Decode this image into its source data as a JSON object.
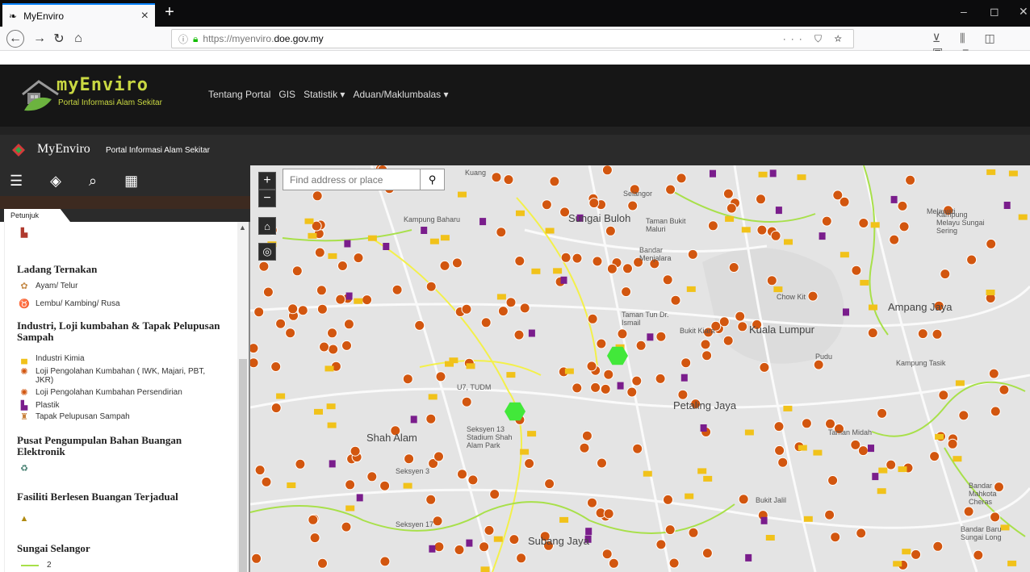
{
  "browser": {
    "tab_title": "MyEnviro",
    "tab_close": "×",
    "new_tab": "+",
    "url_scheme": "https://myenviro.",
    "url_host": "doe.gov.my",
    "url_tools": "··· ⛉ ☆",
    "toolbar_icons": "⊻ ⫼ ◫ ▣ ≡",
    "win_min": "–",
    "win_max": "◻",
    "win_close": "✕"
  },
  "site": {
    "logo_text": "myEnviro",
    "logo_sub": "Portal Informasi Alam Sekitar",
    "nav": [
      "Tentang Portal",
      "GIS",
      "Statistik ▾",
      "Aduan/Maklumbalas ▾"
    ]
  },
  "app": {
    "title": "MyEnviro",
    "subtitle": "Portal Informasi Alam Sekitar"
  },
  "sidebar": {
    "tab": "Petunjuk",
    "legend": [
      {
        "type": "icon",
        "icon": "factory-icon"
      },
      {
        "type": "head",
        "text": "Ladang Ternakan"
      },
      {
        "type": "item",
        "icon": "chicken-icon",
        "text": "Ayam/ Telur"
      },
      {
        "type": "item",
        "icon": "cow-icon",
        "text": "Lembu/ Kambing/ Rusa"
      },
      {
        "type": "head",
        "text": "Industri, Loji kumbahan & Tapak Pelupusan Sampah"
      },
      {
        "type": "item",
        "icon": "chemical-industry-icon",
        "text": "Industri Kimia"
      },
      {
        "type": "item",
        "icon": "sewage-plant-icon",
        "text": "Loji Pengolahan Kumbahan ( IWK, Majari, PBT, JKR)"
      },
      {
        "type": "item",
        "icon": "sewage-plant-icon",
        "text": "Loji Pengolahan Kumbahan Persendirian"
      },
      {
        "type": "item",
        "icon": "plastic-factory-icon",
        "text": "Plastik"
      },
      {
        "type": "item",
        "icon": "landfill-icon",
        "text": "Tapak Pelupusan Sampah"
      },
      {
        "type": "head",
        "text": "Pusat Pengumpulan Bahan Buangan Elektronik"
      },
      {
        "type": "icon",
        "icon": "ewaste-icon"
      },
      {
        "type": "head",
        "text": "Fasiliti Berlesen Buangan Terjadual"
      },
      {
        "type": "icon",
        "icon": "hazard-icon"
      },
      {
        "type": "head",
        "text": "Sungai Selangor"
      },
      {
        "type": "item",
        "icon": "river-line-icon",
        "text": "2"
      }
    ]
  },
  "map": {
    "search_placeholder": "Find address or place",
    "zoom_in": "+",
    "zoom_out": "−",
    "places": [
      {
        "name": "Kuang",
        "cls": ""
      },
      {
        "name": "Selangor",
        "cls": ""
      },
      {
        "name": "Kampung Baharu",
        "cls": ""
      },
      {
        "name": "Sungai Buloh",
        "cls": "big"
      },
      {
        "name": "Taman Bukit Maluri",
        "cls": ""
      },
      {
        "name": "Bandar Menjalara",
        "cls": ""
      },
      {
        "name": "Melawati",
        "cls": ""
      },
      {
        "name": "Kampung Melayu Sungai Sering",
        "cls": ""
      },
      {
        "name": "Chow Kit",
        "cls": ""
      },
      {
        "name": "Ampang Jaya",
        "cls": "big"
      },
      {
        "name": "Taman Tun Dr. Ismail",
        "cls": ""
      },
      {
        "name": "Bukit Kiara",
        "cls": ""
      },
      {
        "name": "Kuala Lumpur",
        "cls": "big"
      },
      {
        "name": "Pudu",
        "cls": ""
      },
      {
        "name": "Kampung Tasik",
        "cls": ""
      },
      {
        "name": "U7, TUDM",
        "cls": ""
      },
      {
        "name": "Petaling Jaya",
        "cls": "big"
      },
      {
        "name": "Seksyen 13 Stadium Shah Alam Park",
        "cls": ""
      },
      {
        "name": "Shah Alam",
        "cls": "big"
      },
      {
        "name": "Taman Midah",
        "cls": ""
      },
      {
        "name": "Seksyen 3",
        "cls": ""
      },
      {
        "name": "Bukit Jalil",
        "cls": ""
      },
      {
        "name": "Bandar Mahkota Cheras",
        "cls": ""
      },
      {
        "name": "Seksyen 17",
        "cls": ""
      },
      {
        "name": "Subang Jaya",
        "cls": "big"
      },
      {
        "name": "Bandar Baru Sungai Long",
        "cls": ""
      }
    ]
  },
  "colors": {
    "sewage": "#d2560f",
    "industry": "#f1c21a",
    "plastic": "#7a1d8c",
    "river": "#a8e04a",
    "road": "#f3f04a",
    "hexagon": "#42e83a"
  }
}
